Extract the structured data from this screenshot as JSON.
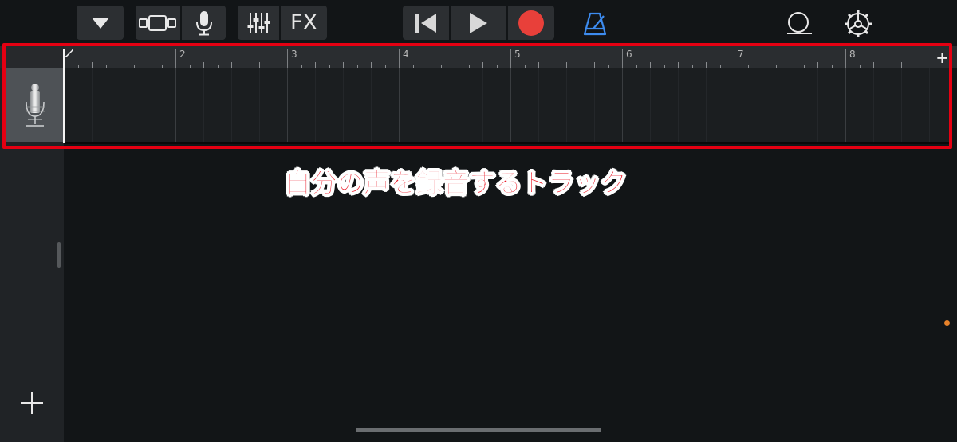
{
  "toolbar": {
    "fx_label": "FX"
  },
  "ruler": {
    "bars": [
      "2",
      "3",
      "4",
      "5",
      "6",
      "7",
      "8"
    ],
    "add_label": "+"
  },
  "tracks": [
    {
      "instrument": "microphone-icon"
    }
  ],
  "annotation": {
    "caption": "自分の声を録音するトラック",
    "color": "#e50012"
  },
  "colors": {
    "record": "#e8403a",
    "metronome": "#3d8cf0",
    "accent_dot": "#e8822a"
  }
}
